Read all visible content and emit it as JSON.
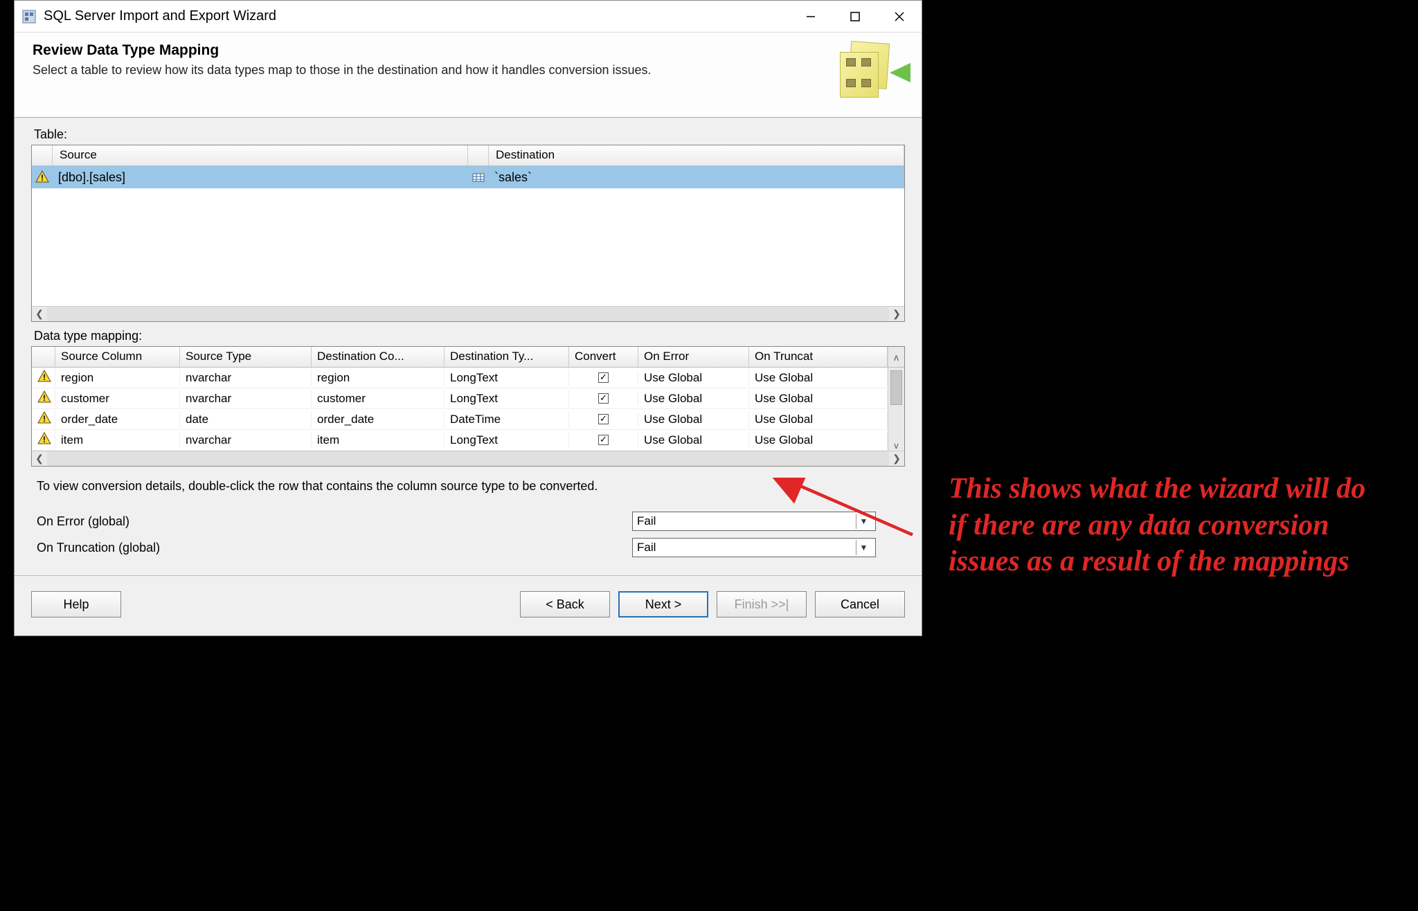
{
  "window": {
    "title": "SQL Server Import and Export Wizard"
  },
  "header": {
    "title": "Review Data Type Mapping",
    "subtitle": "Select a table to review how its data types map to those in the destination and how it handles conversion issues."
  },
  "table_section": {
    "label": "Table:",
    "columns": {
      "source": "Source",
      "destination": "Destination"
    },
    "row": {
      "source": "[dbo].[sales]",
      "destination": "`sales`"
    }
  },
  "mapping_section": {
    "label": "Data type mapping:",
    "columns": {
      "source_col": "Source Column",
      "source_type": "Source Type",
      "dest_col": "Destination Co...",
      "dest_type": "Destination Ty...",
      "convert": "Convert",
      "on_error": "On Error",
      "on_trunc": "On Truncat"
    },
    "rows": [
      {
        "scol": "region",
        "stype": "nvarchar",
        "dcol": "region",
        "dtype": "LongText",
        "conv": true,
        "onerr": "Use Global",
        "ontrunc": "Use Global"
      },
      {
        "scol": "customer",
        "stype": "nvarchar",
        "dcol": "customer",
        "dtype": "LongText",
        "conv": true,
        "onerr": "Use Global",
        "ontrunc": "Use Global"
      },
      {
        "scol": "order_date",
        "stype": "date",
        "dcol": "order_date",
        "dtype": "DateTime",
        "conv": true,
        "onerr": "Use Global",
        "ontrunc": "Use Global"
      },
      {
        "scol": "item",
        "stype": "nvarchar",
        "dcol": "item",
        "dtype": "LongText",
        "conv": true,
        "onerr": "Use Global",
        "ontrunc": "Use Global"
      }
    ],
    "scroll_up": "ʌ",
    "scroll_down": "v"
  },
  "hint": "To view conversion details, double-click the row that contains the column source type to be converted.",
  "globals": {
    "on_error_label": "On Error (global)",
    "on_trunc_label": "On Truncation (global)",
    "on_error_value": "Fail",
    "on_trunc_value": "Fail"
  },
  "footer": {
    "help": "Help",
    "back": "< Back",
    "next": "Next >",
    "finish": "Finish >>|",
    "cancel": "Cancel"
  },
  "annotation": "This shows what the wizard will do if there are any data conversion issues as a result of the mappings"
}
